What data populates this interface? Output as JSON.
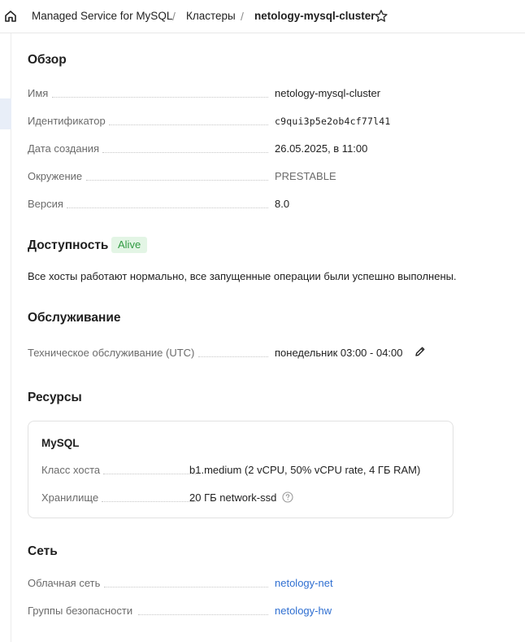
{
  "breadcrumbs": {
    "service": "Managed Service for MySQL",
    "separator": "/",
    "clusters": "Кластеры",
    "cluster": "netology-mysql-cluster"
  },
  "overview": {
    "title": "Обзор",
    "fields": [
      {
        "label": "Имя",
        "value": "netology-mysql-cluster"
      },
      {
        "label": "Идентификатор",
        "value": "c9qui3p5e2ob4cf77l41"
      },
      {
        "label": "Дата создания",
        "value": "26.05.2025, в 11:00"
      },
      {
        "label": "Окружение",
        "value": "PRESTABLE"
      },
      {
        "label": "Версия",
        "value": "8.0"
      }
    ]
  },
  "availability": {
    "title": "Доступность",
    "status": "Alive",
    "description": "Все хосты работают нормально, все запущенные операции были успешно выполнены."
  },
  "maintenance": {
    "title": "Обслуживание",
    "label": "Техническое обслуживание (UTC)",
    "value": "понедельник 03:00 - 04:00"
  },
  "resources": {
    "title": "Ресурсы",
    "card_title": "MySQL",
    "fields": [
      {
        "label": "Класс хоста",
        "value": "b1.medium (2 vCPU, 50% vCPU rate, 4 ГБ RAM)"
      },
      {
        "label": "Хранилище",
        "value": "20 ГБ network-ssd"
      }
    ]
  },
  "network": {
    "title": "Сеть",
    "fields": [
      {
        "label": "Облачная сеть",
        "value": "netology-net"
      },
      {
        "label": "Группы безопасности",
        "value": "netology-hw"
      }
    ]
  },
  "colors": {
    "link": "#2f6fd1",
    "status_bg": "#e3f5e5",
    "status_text": "#2f9a41"
  },
  "icons": [
    "home-icon",
    "star-icon",
    "pencil-icon",
    "question-circle-icon"
  ]
}
